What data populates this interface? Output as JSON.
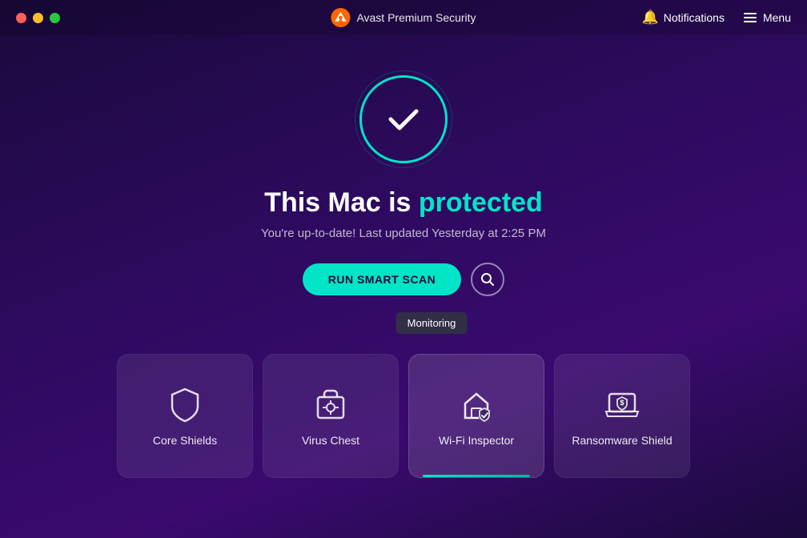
{
  "titleBar": {
    "appName": "Avast Premium Security",
    "notifications": "Notifications",
    "menu": "Menu"
  },
  "hero": {
    "statusTitle1": "This Mac is ",
    "statusTitleHighlight": "protected",
    "subtitle": "You're up-to-date! Last updated Yesterday at 2:25 PM",
    "scanButton": "RUN SMART SCAN",
    "monitoringTooltip": "Monitoring"
  },
  "cards": [
    {
      "id": "core-shields",
      "label": "Core Shields",
      "icon": "shield",
      "active": false
    },
    {
      "id": "virus-chest",
      "label": "Virus Chest",
      "icon": "virus-chest",
      "active": false
    },
    {
      "id": "wifi-inspector",
      "label": "Wi-Fi Inspector",
      "icon": "wifi",
      "active": true
    },
    {
      "id": "ransomware-shield",
      "label": "Ransomware Shield",
      "icon": "ransomware",
      "active": false
    }
  ]
}
